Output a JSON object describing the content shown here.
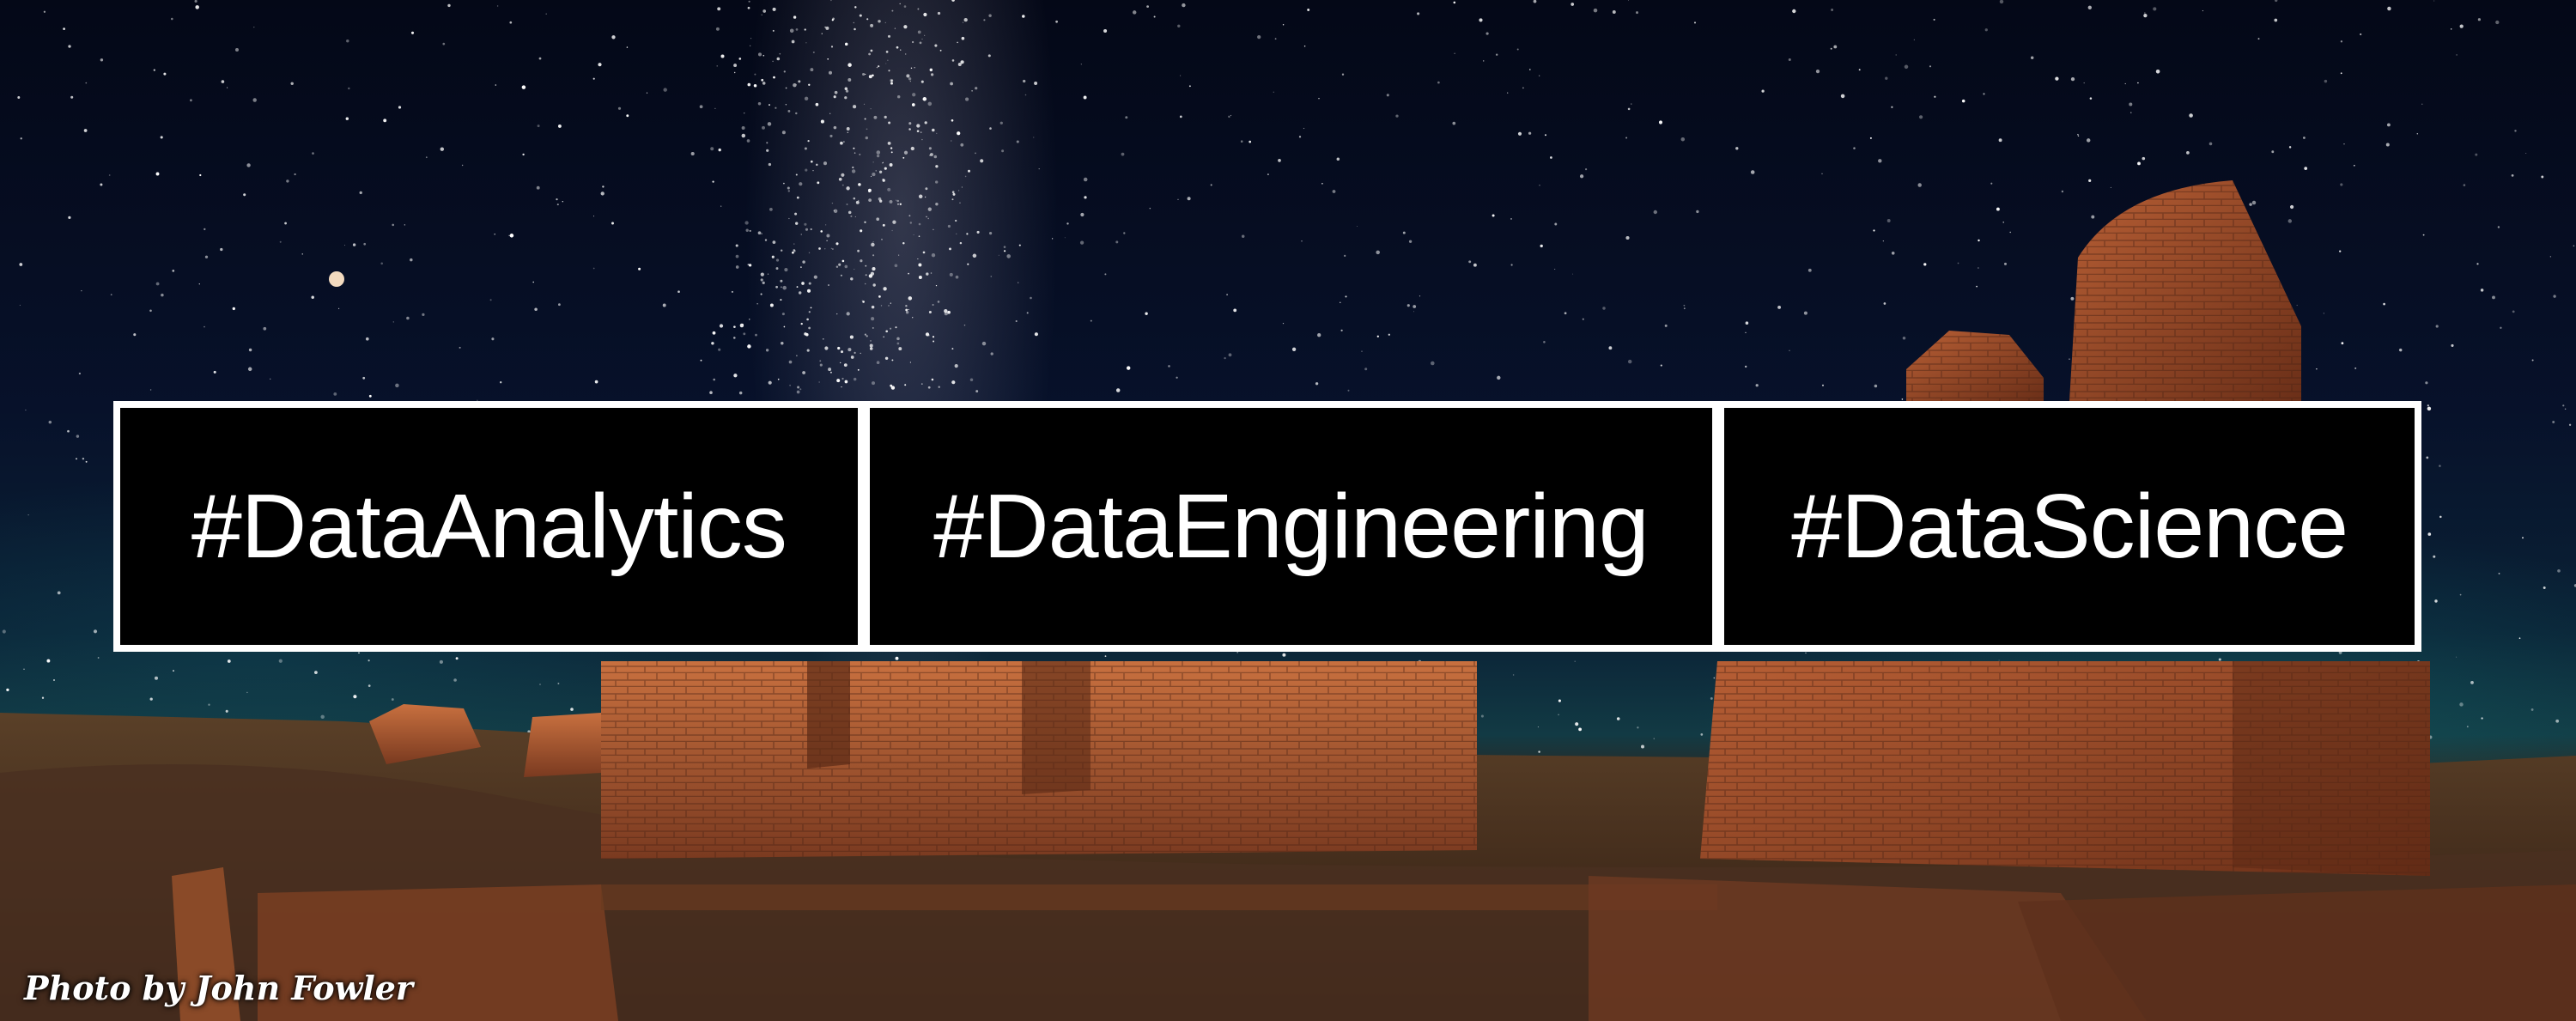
{
  "tags": [
    {
      "label": "#DataAnalytics"
    },
    {
      "label": "#DataEngineering"
    },
    {
      "label": "#DataScience"
    }
  ],
  "photo_credit": "Photo by  John Fowler",
  "colors": {
    "banner_border": "#ffffff",
    "tag_background": "#000000",
    "tag_text": "#ffffff",
    "sky": "#07112a",
    "ruins": "#a0522d"
  }
}
